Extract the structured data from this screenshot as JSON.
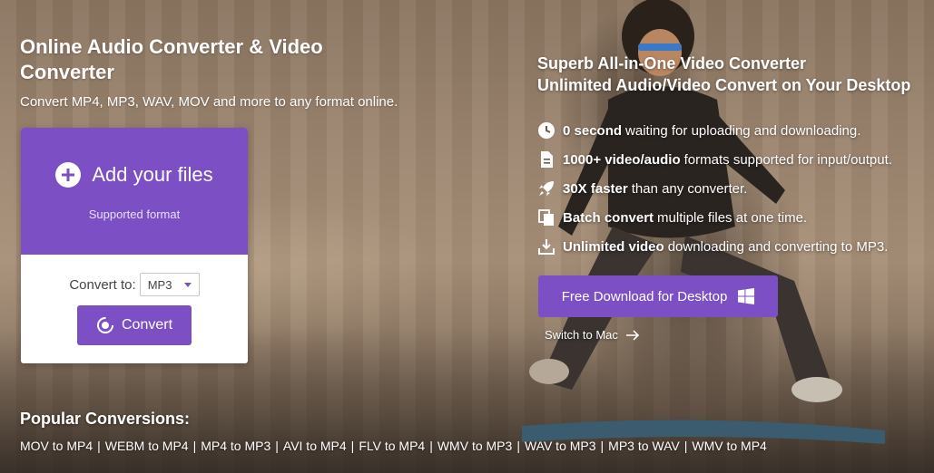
{
  "hero": {
    "title": "Online Audio Converter & Video Converter",
    "subtitle": "Convert MP4, MP3, WAV, MOV and more to any format online."
  },
  "upload_card": {
    "add_files_label": "Add your files",
    "supported_format_link": "Supported format",
    "convert_to_label": "Convert to:",
    "format_selected": "MP3",
    "convert_button": "Convert"
  },
  "desktop_promo": {
    "title_line1": "Superb All-in-One Video Converter",
    "title_line2": "Unlimited Audio/Video Convert on Your Desktop",
    "features": [
      {
        "icon": "clock-icon",
        "bold": "0 second",
        "text": "waiting for uploading and downloading."
      },
      {
        "icon": "file-icon",
        "bold": "1000+ video/audio",
        "text": "formats supported for input/output."
      },
      {
        "icon": "rocket-icon",
        "bold": "30X faster",
        "text": "than any converter."
      },
      {
        "icon": "copy-files-icon",
        "bold": "Batch convert",
        "text": "multiple files at one time."
      },
      {
        "icon": "download-icon",
        "bold": "Unlimited video",
        "text": "downloading and converting to MP3."
      }
    ],
    "download_button": "Free Download for Desktop",
    "switch_link": "Switch to Mac"
  },
  "popular": {
    "title": "Popular Conversions:",
    "links": [
      "MOV to MP4",
      "WEBM to MP4",
      "MP4 to MP3",
      "AVI to MP4",
      "FLV to MP4",
      "WMV to MP3",
      "WAV to MP3",
      "MP3 to WAV",
      "WMV to MP4"
    ],
    "separator": "|"
  },
  "colors": {
    "accent": "#7c4fc4",
    "text_on_dark": "#ffffff"
  }
}
